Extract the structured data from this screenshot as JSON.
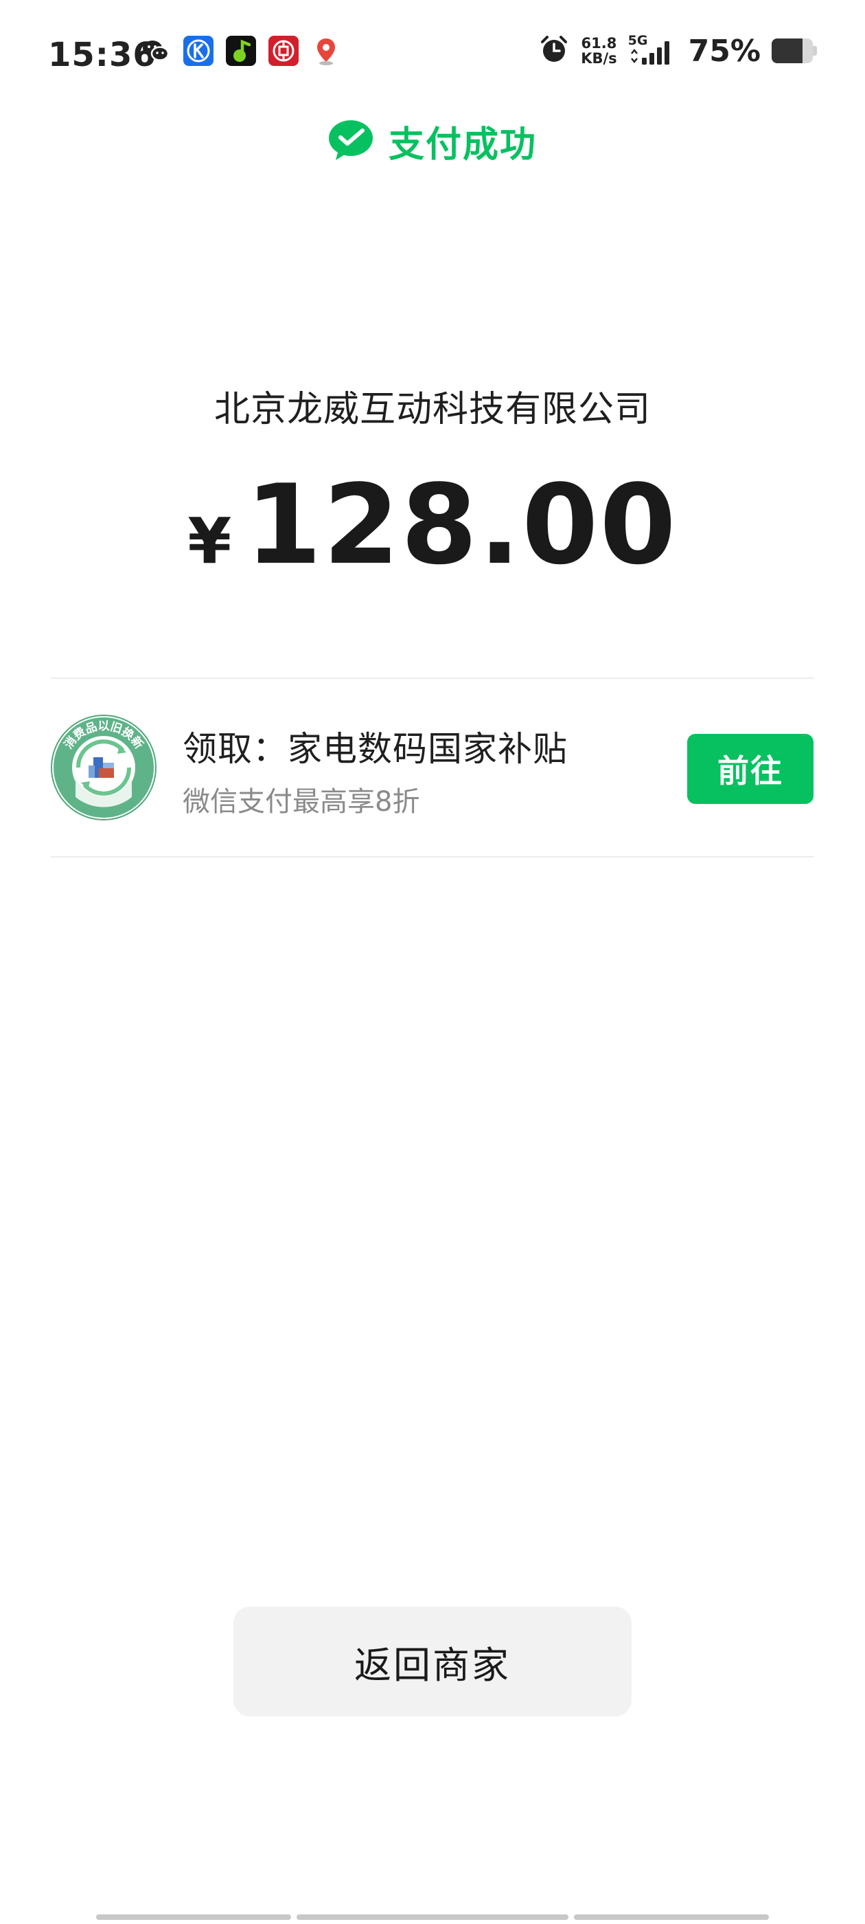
{
  "status_bar": {
    "time": "15:36",
    "net_speed_value": "61.8",
    "net_speed_unit": "KB/s",
    "signal_type": "5G",
    "battery_percent": "75%",
    "battery_level": 0.75,
    "notification_icons": [
      "wechat-icon",
      "k-app-icon",
      "music-app-icon",
      "bank-app-icon",
      "map-pin-icon"
    ]
  },
  "header": {
    "title": "支付成功",
    "icon": "wechat-pay-icon",
    "accent_color": "#07c160"
  },
  "payment": {
    "merchant": "北京龙威互动科技有限公司",
    "currency_symbol": "¥",
    "amount": "128.00"
  },
  "promo": {
    "logo_text": "消费品以旧换新",
    "title": "领取：家电数码国家补贴",
    "subtitle": "微信支付最高享8折",
    "button_label": "前往"
  },
  "footer": {
    "return_label": "返回商家"
  }
}
